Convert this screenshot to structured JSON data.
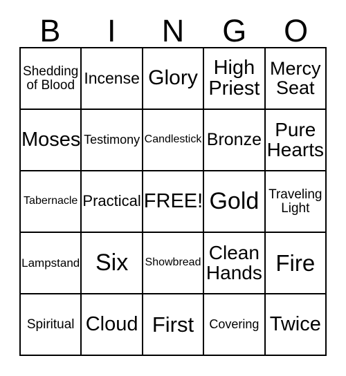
{
  "header": {
    "letters": [
      "B",
      "I",
      "N",
      "G",
      "O"
    ]
  },
  "grid": {
    "rows": [
      [
        {
          "text": "Shedding of Blood",
          "lines": [
            "Shedding",
            "of Blood"
          ],
          "font_size": 19
        },
        {
          "text": "Incense",
          "lines": [
            "Incense"
          ],
          "font_size": 23
        },
        {
          "text": "Glory",
          "lines": [
            "Glory"
          ],
          "font_size": 30
        },
        {
          "text": "High Priest",
          "lines": [
            "High",
            "Priest"
          ],
          "font_size": 29
        },
        {
          "text": "Mercy Seat",
          "lines": [
            "Mercy",
            "Seat"
          ],
          "font_size": 27
        }
      ],
      [
        {
          "text": "Moses",
          "lines": [
            "Moses"
          ],
          "font_size": 29
        },
        {
          "text": "Testimony",
          "lines": [
            "Testimony"
          ],
          "font_size": 18
        },
        {
          "text": "Candlestick",
          "lines": [
            "Candlestick"
          ],
          "font_size": 16
        },
        {
          "text": "Bronze",
          "lines": [
            "Bronze"
          ],
          "font_size": 25
        },
        {
          "text": "Pure Hearts",
          "lines": [
            "Pure",
            "Hearts"
          ],
          "font_size": 28
        }
      ],
      [
        {
          "text": "Tabernacle",
          "lines": [
            "Tabernacle"
          ],
          "font_size": 16
        },
        {
          "text": "Practical",
          "lines": [
            "Practical"
          ],
          "font_size": 22
        },
        {
          "text": "FREE!",
          "lines": [
            "FREE!"
          ],
          "font_size": 29
        },
        {
          "text": "Gold",
          "lines": [
            "Gold"
          ],
          "font_size": 34
        },
        {
          "text": "Traveling Light",
          "lines": [
            "Traveling",
            "Light"
          ],
          "font_size": 19
        }
      ],
      [
        {
          "text": "Lampstand",
          "lines": [
            "Lampstand"
          ],
          "font_size": 17
        },
        {
          "text": "Six",
          "lines": [
            "Six"
          ],
          "font_size": 34
        },
        {
          "text": "Showbread",
          "lines": [
            "Showbread"
          ],
          "font_size": 16
        },
        {
          "text": "Clean Hands",
          "lines": [
            "Clean",
            "Hands"
          ],
          "font_size": 28
        },
        {
          "text": "Fire",
          "lines": [
            "Fire"
          ],
          "font_size": 33
        }
      ],
      [
        {
          "text": "Spiritual",
          "lines": [
            "Spiritual"
          ],
          "font_size": 19
        },
        {
          "text": "Cloud",
          "lines": [
            "Cloud"
          ],
          "font_size": 29
        },
        {
          "text": "First",
          "lines": [
            "First"
          ],
          "font_size": 31
        },
        {
          "text": "Covering",
          "lines": [
            "Covering"
          ],
          "font_size": 18
        },
        {
          "text": "Twice",
          "lines": [
            "Twice"
          ],
          "font_size": 29
        }
      ]
    ]
  },
  "colors": {
    "border": "#000000",
    "text": "#000000",
    "background": "#ffffff"
  }
}
